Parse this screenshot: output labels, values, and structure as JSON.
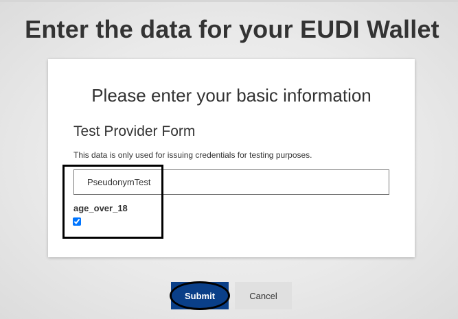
{
  "page": {
    "title": "Enter the data for your EUDI Wallet"
  },
  "card": {
    "heading": "Please enter your basic information",
    "form_title": "Test Provider Form",
    "note": "This data is only used for issuing credentials for testing purposes."
  },
  "fields": {
    "pseudonym_value": "PseudonymTest",
    "age_label": "age_over_18",
    "age_checked": true
  },
  "buttons": {
    "submit_label": "Submit",
    "cancel_label": "Cancel"
  },
  "colors": {
    "submit_bg": "#0a3f88",
    "cancel_bg": "#e0e0e0",
    "annotation": "#000000"
  }
}
